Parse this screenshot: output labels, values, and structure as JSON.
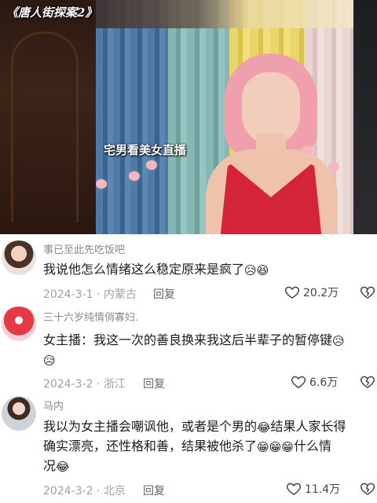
{
  "video": {
    "show_title": "《唐人街探案2》",
    "caption": "宅男看美女直播"
  },
  "comments": [
    {
      "username": "事已至此先吃饭吧",
      "text_before": "我说他怎么情绪这么稳定原来是疯了",
      "emojis": [
        "😥",
        "😆"
      ],
      "date_location": "2024-3-1 · 内蒙古",
      "reply_label": "回复",
      "likes": "20.2万"
    },
    {
      "username": "三十六岁纯情俏寡妇.",
      "text_line1": "女主播：我这一次的善良换来我这后半辈子的暂停键",
      "emoji_inline": "😥",
      "emoji_line2": "😥",
      "date_location": "2024-3-2 · 浙江",
      "reply_label": "回复",
      "likes": "6.6万"
    },
    {
      "username": "马内",
      "text_line1a": "我以为女主播会嘲讽他，或者是个男的",
      "emoji_1": "😂",
      "text_line1b": "结果人家长得",
      "text_line2a": "确实漂亮，还性格和善，结果被他杀了",
      "emoji_2": "😁",
      "emoji_3": "😁",
      "emoji_4": "😁",
      "text_line2b": "什么情",
      "text_line3": "况",
      "emoji_5": "😂",
      "date_location": "2024-3-2 · 北京",
      "reply_label": "回复",
      "likes": "11.4万"
    }
  ],
  "icons": {
    "like": "heart-outline-icon",
    "dislike": "broken-heart-icon"
  }
}
